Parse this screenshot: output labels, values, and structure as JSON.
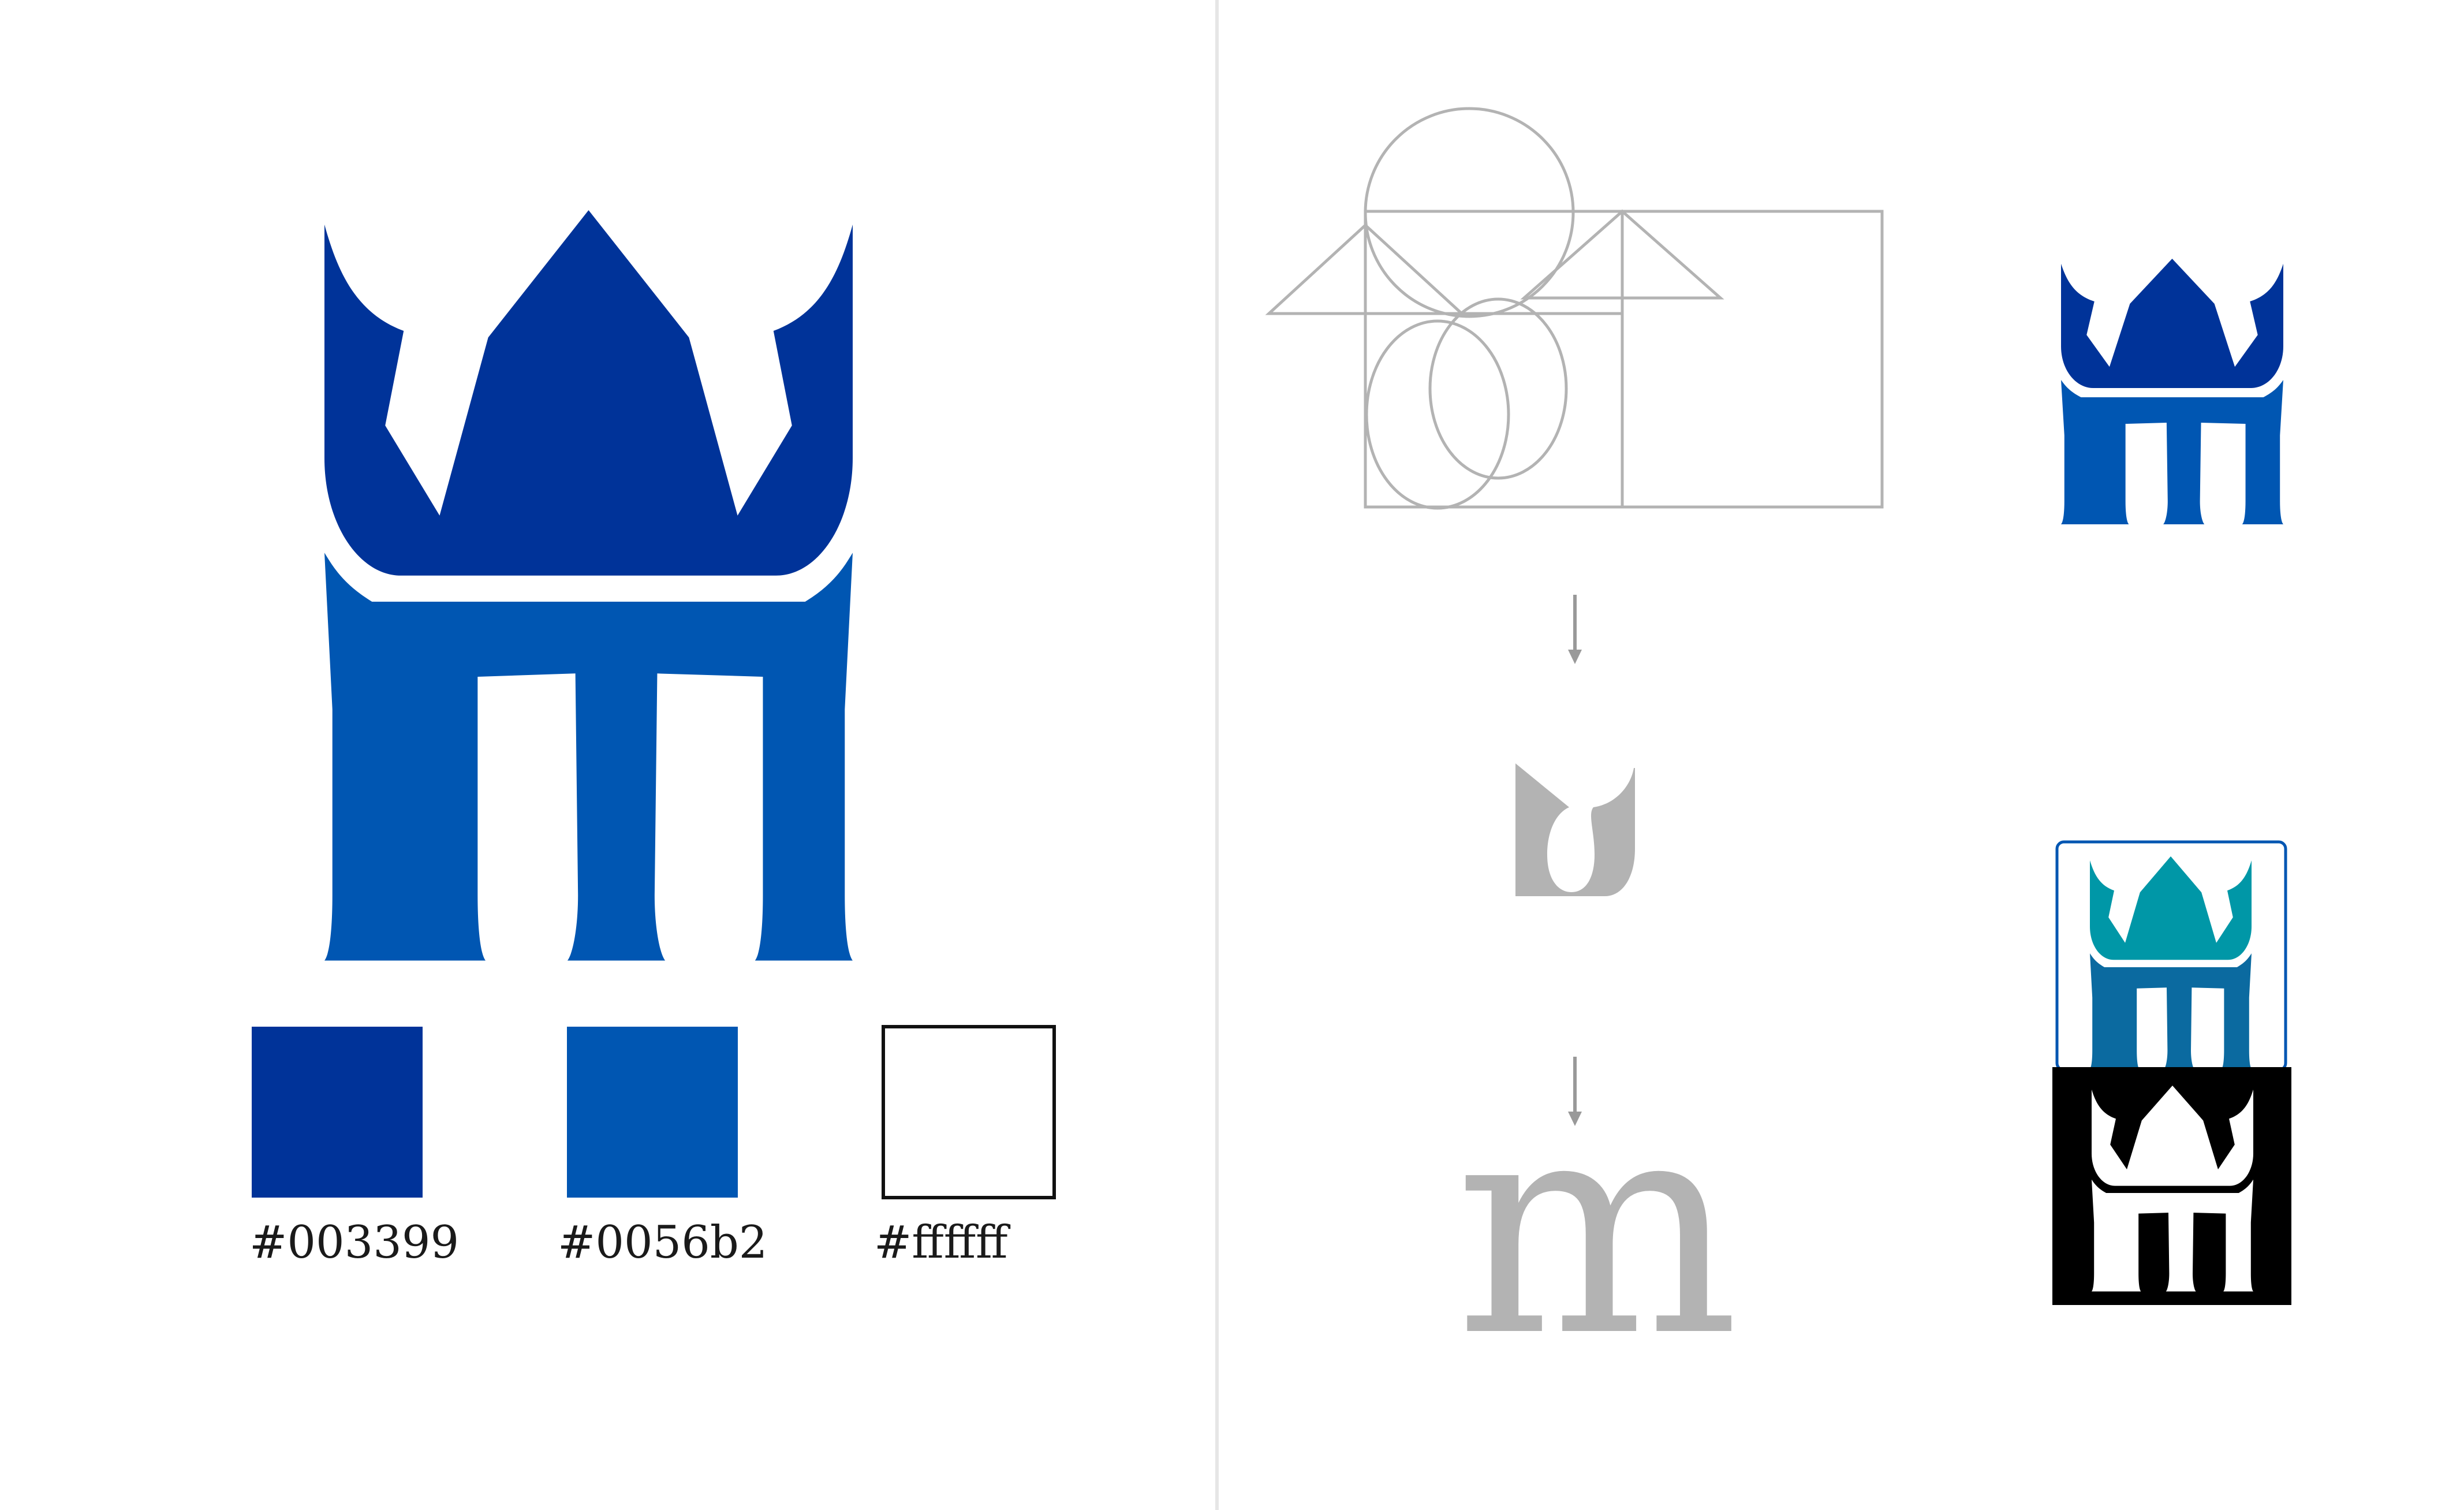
{
  "palette": {
    "swatches": [
      {
        "label": "#003399",
        "color": "#003399"
      },
      {
        "label": "#0056b2",
        "color": "#0056b2"
      },
      {
        "label": "#ffffff",
        "color": "#ffffff"
      }
    ]
  },
  "construction": {
    "letter": "m",
    "guide_color": "#b3b3b3"
  },
  "colors": {
    "crown_primary": "#003399",
    "base_primary": "#0056b2",
    "teal_crown": "#0097a7",
    "teal_base": "#0b6aa0",
    "mono_bg": "#000000",
    "mono_fg": "#ffffff",
    "divider": "#e6e6e6"
  },
  "icons": {
    "main_logo": "crown-m-logo-icon",
    "arrow": "arrow-down-icon"
  }
}
